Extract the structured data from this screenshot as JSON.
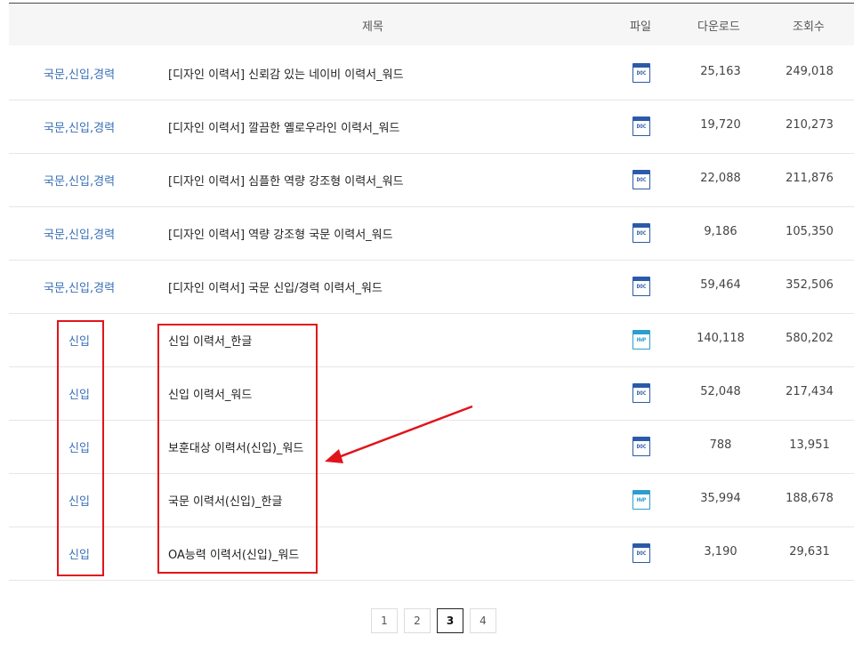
{
  "header": {
    "title_col": "제목",
    "file_col": "파일",
    "download_col": "다운로드",
    "views_col": "조회수"
  },
  "rows": [
    {
      "category": "국문,신입,경력",
      "title": "[디자인 이력서] 신뢰감 있는 네이비 이력서_워드",
      "file": "DOC",
      "downloads": "25,163",
      "views": "249,018"
    },
    {
      "category": "국문,신입,경력",
      "title": "[디자인 이력서] 깔끔한 옐로우라인 이력서_워드",
      "file": "DOC",
      "downloads": "19,720",
      "views": "210,273"
    },
    {
      "category": "국문,신입,경력",
      "title": "[디자인 이력서] 심플한 역량 강조형 이력서_워드",
      "file": "DOC",
      "downloads": "22,088",
      "views": "211,876"
    },
    {
      "category": "국문,신입,경력",
      "title": "[디자인 이력서] 역량 강조형 국문 이력서_워드",
      "file": "DOC",
      "downloads": "9,186",
      "views": "105,350"
    },
    {
      "category": "국문,신입,경력",
      "title": "[디자인 이력서] 국문 신입/경력 이력서_워드",
      "file": "DOC",
      "downloads": "59,464",
      "views": "352,506"
    },
    {
      "category": "신입",
      "title": "신입 이력서_한글",
      "file": "HWP",
      "downloads": "140,118",
      "views": "580,202"
    },
    {
      "category": "신입",
      "title": "신입 이력서_워드",
      "file": "DOC",
      "downloads": "52,048",
      "views": "217,434"
    },
    {
      "category": "신입",
      "title": "보훈대상 이력서(신입)_워드",
      "file": "DOC",
      "downloads": "788",
      "views": "13,951"
    },
    {
      "category": "신입",
      "title": "국문 이력서(신입)_한글",
      "file": "HWP",
      "downloads": "35,994",
      "views": "188,678"
    },
    {
      "category": "신입",
      "title": "OA능력 이력서(신입)_워드",
      "file": "DOC",
      "downloads": "3,190",
      "views": "29,631"
    }
  ],
  "pagination": {
    "pages": [
      "1",
      "2",
      "3",
      "4"
    ],
    "current": "3"
  },
  "annotation_color": "#e1141b"
}
